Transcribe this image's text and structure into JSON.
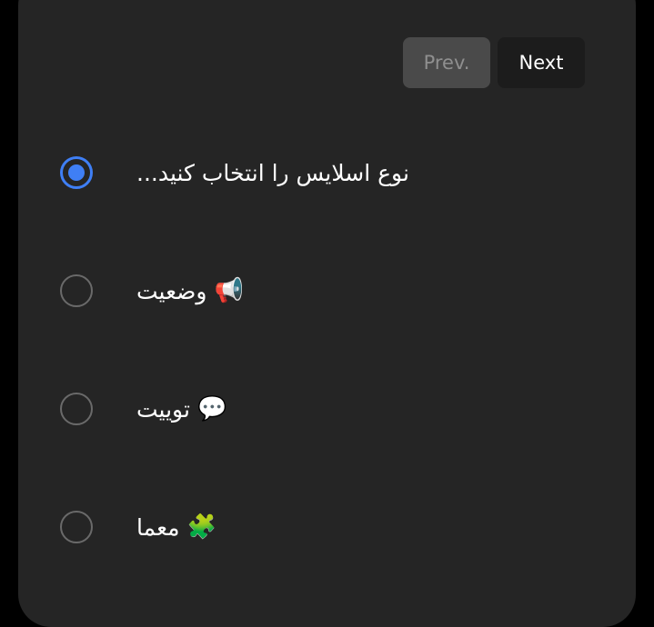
{
  "nav": {
    "prev_label": "Prev.",
    "next_label": "Next"
  },
  "options": [
    {
      "label": "نوع اسلایس را انتخاب کنید...",
      "icon": "",
      "selected": true
    },
    {
      "label": "وضعیت",
      "icon": "📢",
      "icon_name": "megaphone-icon",
      "selected": false
    },
    {
      "label": "توییت",
      "icon": "💬",
      "icon_name": "speech-bubble-icon",
      "selected": false
    },
    {
      "label": "معما",
      "icon": "🧩",
      "icon_name": "puzzle-piece-icon",
      "selected": false
    }
  ],
  "colors": {
    "accent": "#3f7ff5",
    "panel": "#252525",
    "background": "#000000"
  }
}
